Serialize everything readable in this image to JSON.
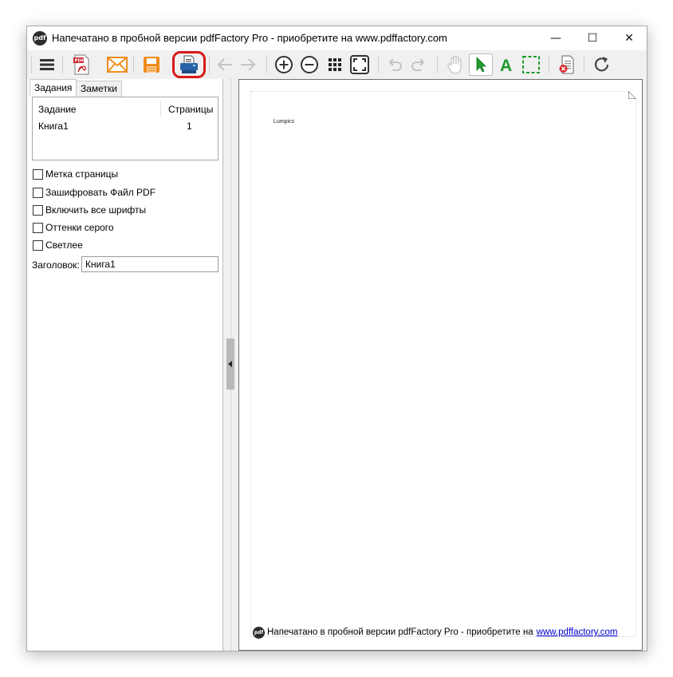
{
  "window": {
    "app_icon_text": "pdf",
    "title": "Напечатано в пробной версии pdfFactory Pro - приобретите на www.pdffactory.com",
    "minimize": "—",
    "maximize": "☐",
    "close": "✕"
  },
  "toolbar": {
    "items": [
      {
        "name": "menu-icon"
      },
      {
        "name": "save-pdf-icon",
        "badge": "PDF"
      },
      {
        "name": "email-icon"
      },
      {
        "name": "save-icon"
      },
      {
        "name": "print-icon",
        "highlighted": true
      },
      {
        "name": "back-arrow-icon",
        "disabled": true
      },
      {
        "name": "forward-arrow-icon",
        "disabled": true
      },
      {
        "name": "zoom-in-icon"
      },
      {
        "name": "zoom-out-icon"
      },
      {
        "name": "thumbnails-grid-icon"
      },
      {
        "name": "fit-page-icon"
      },
      {
        "name": "undo-icon",
        "disabled": true
      },
      {
        "name": "redo-icon",
        "disabled": true
      },
      {
        "name": "hand-tool-icon",
        "disabled": true
      },
      {
        "name": "select-arrow-icon",
        "active": true
      },
      {
        "name": "text-tool-icon",
        "label": "A"
      },
      {
        "name": "marquee-select-icon"
      },
      {
        "name": "delete-page-icon"
      },
      {
        "name": "refresh-icon"
      }
    ],
    "accent_green": "#1f9a2e",
    "highlight_color": "#d81a1a"
  },
  "left_panel": {
    "tabs": [
      {
        "label": "Задания",
        "active": true
      },
      {
        "label": "Заметки",
        "active": false
      }
    ],
    "job_list": {
      "columns": [
        "Задание",
        "Страницы"
      ],
      "rows": [
        {
          "job": "Книга1",
          "pages": "1"
        }
      ]
    },
    "options": [
      {
        "label": "Метка страницы",
        "checked": false
      },
      {
        "label": "Зашифровать Файл PDF",
        "checked": false
      },
      {
        "label": "Включить все шрифты",
        "checked": false
      },
      {
        "label": "Оттенки серого",
        "checked": false
      },
      {
        "label": "Светлее",
        "checked": false
      }
    ],
    "title_label": "Заголовок:",
    "title_value": "Книга1"
  },
  "preview": {
    "page_text": "Lumpics",
    "footer": {
      "logo_text": "pdf",
      "text": "Напечатано в пробной версии pdfFactory Pro - приобретите на",
      "link": "www.pdffactory.com"
    }
  }
}
